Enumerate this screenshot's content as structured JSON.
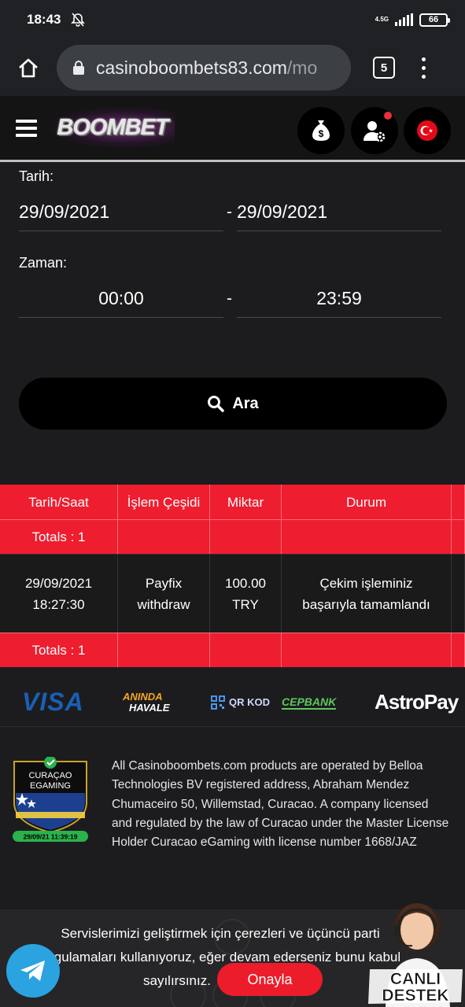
{
  "status_bar": {
    "time": "18:43",
    "network": "4.5G",
    "battery": "66"
  },
  "browser": {
    "url_main": "casinoboombets83.com",
    "url_rest": "/mo",
    "tab_count": "5"
  },
  "header": {
    "logo": "BOOMBET"
  },
  "filter": {
    "date_label": "Tarih:",
    "date_from": "29/09/2021",
    "date_to": "29/09/2021",
    "time_label": "Zaman:",
    "time_from": "00:00",
    "time_to": "23:59",
    "separator": "-",
    "search_label": "Ara"
  },
  "table": {
    "headers": [
      "Tarih/Saat",
      "İşlem Çeşidi",
      "Miktar",
      "Durum"
    ],
    "totals_label": "Totals : 1",
    "rows": [
      {
        "date": "29/09/2021",
        "time": "18:27:30",
        "type_1": "Payfix",
        "type_2": "withdraw",
        "amount": "100.00",
        "currency": "TRY",
        "status_1": "Çekim işleminiz",
        "status_2": "başarıyla tamamlandı"
      }
    ]
  },
  "payments": {
    "visa": "VISA",
    "aninda_1": "ANINDA",
    "aninda_2": "HAVALE",
    "qr": "QR KOD",
    "cepbank": "CEPBANK",
    "astropay": "AstroPay"
  },
  "license": {
    "badge_title_1": "CURAÇAO",
    "badge_title_2": "EGAMING",
    "badge_date": "29/09/21  11:39:19",
    "text": "All Casinoboombets.com products are operated by Belloa Technologies BV registered address, Abraham Mendez Chumaceiro 50, Willemstad, Curacao. A company licensed and regulated by the law of Curacao under the Master License Holder Curacao eGaming with license number 1668/JAZ"
  },
  "cookie": {
    "line_1": "Servislerimizi geliştirmek için çerezleri ve üçüncü parti",
    "line_2": "uygulamaları kullanıyoruz, eğer devam ederseniz bunu kabul",
    "line_3": "sayılırsınız.",
    "accept_label": "Onayla"
  },
  "live_support": {
    "line_1": "CANLI",
    "line_2": "DESTEK"
  },
  "colors": {
    "accent_red": "#ee1d2f",
    "background": "#1c1c1e",
    "telegram": "#2aa3e0"
  }
}
